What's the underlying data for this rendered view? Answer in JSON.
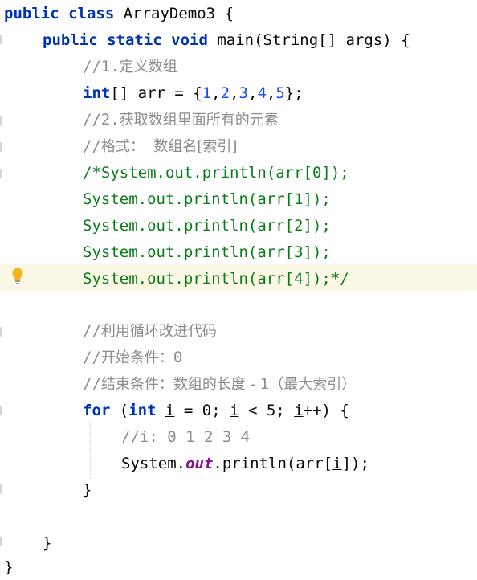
{
  "code": {
    "class_decl": {
      "kw": "public class",
      "name": " ArrayDemo3 {"
    },
    "main_decl": {
      "kw": "public static void",
      "rest": " main(String[] args) {"
    },
    "comment_define_prefix": "//1.",
    "comment_define_text": "定义数组",
    "array_decl": {
      "type": "int",
      "before": "[] arr = {",
      "values": [
        "1",
        "2",
        "3",
        "4",
        "5"
      ],
      "after": "};"
    },
    "comment_get_prefix": "//2.",
    "comment_get_text": "获取数组里面所有的元素",
    "comment_format_prefix": "//",
    "comment_format_text": "格式：  数组名[索引]",
    "block_comment_lines": [
      "/*System.out.println(arr[0]);",
      "System.out.println(arr[1]);",
      "System.out.println(arr[2]);",
      "System.out.println(arr[3]);",
      "System.out.println(arr[4]);*/"
    ],
    "comment_loop_prefix": "//",
    "comment_loop_text": "利用循环改进代码",
    "comment_start_prefix": "//",
    "comment_start_text": "开始条件：",
    "comment_start_value": "0",
    "comment_end_prefix": "//",
    "comment_end_text": "结束条件：数组的长度 - 1（最大索引）",
    "for_loop": {
      "kw_for": "for",
      "paren_open": " (",
      "kw_int": "int",
      "sp1": " ",
      "var1": "i",
      "init": " = 0; ",
      "var2": "i",
      "cond": " < 5; ",
      "var3": "i",
      "incr": "++) {"
    },
    "comment_i": "//i: 0 1 2 3 4",
    "print_stmt": {
      "prefix": "System.",
      "field": "out",
      "mid": ".println(arr[",
      "var": "i",
      "suffix": "]);"
    },
    "close_for": "}",
    "close_main": "}",
    "close_class": "}"
  },
  "colors": {
    "keyword": "#0033b3",
    "comment": "#8c8c8c",
    "block_comment": "#067d17",
    "number": "#1750eb",
    "static_field": "#871094",
    "highlight_line": "#fbf8e6",
    "bulb": "#f2b51c"
  },
  "icons": {
    "gutter": "lightbulb-icon"
  }
}
